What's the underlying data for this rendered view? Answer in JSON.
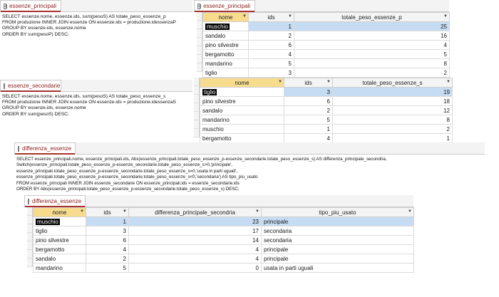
{
  "panels": {
    "sql1": {
      "tab": "essenze_principali",
      "sql": "SELECT essenze.nome, essenze.ids, sum(pesoS) AS totale_peso_essenze_p\nFROM produzione INNER JOIN essenze ON essenze.ids = produzione.idessenzaP\nGROUP BY essenze.ids, essenze.nome\nORDER BY sum(pesoP) DESC;"
    },
    "grid1": {
      "tab": "essenze_principali",
      "columns": [
        "nome",
        "ids",
        "totale_peso_essenze_p"
      ],
      "rows": [
        [
          "muschio",
          "1",
          "25"
        ],
        [
          "sandalo",
          "2",
          "16"
        ],
        [
          "pino silvestre",
          "6",
          "4"
        ],
        [
          "bergamotto",
          "4",
          "5"
        ],
        [
          "mandarino",
          "5",
          "8"
        ],
        [
          "tiglio",
          "3",
          "2"
        ]
      ]
    },
    "sql2": {
      "tab": "essenze_secondarie",
      "sql": "SELECT essenze.nome, essenze.ids, sum(pesoS) AS totale_peso_essenze_s\nFROM produzione INNER JOIN essenze ON essenze.ids = produzione.idessenzaS\nGROUP BY essenze.ids, essenze.nome\nORDER BY sum(pesoS) DESC;"
    },
    "grid2": {
      "columns": [
        "nome",
        "ids",
        "totale_peso_essenze_s"
      ],
      "rows": [
        [
          "tiglio",
          "3",
          "19"
        ],
        [
          "pino silvestre",
          "6",
          "18"
        ],
        [
          "sandalo",
          "2",
          "12"
        ],
        [
          "mandarino",
          "5",
          "8"
        ],
        [
          "muschio",
          "1",
          "2"
        ],
        [
          "bergamotto",
          "4",
          "1"
        ]
      ]
    },
    "sql3": {
      "tab": "differenza_essenze",
      "sql": "SELECT essenze_principali.nome, essenze_principali.ids, Abs(essenze_principali.totale_peso_essenze_p-essenze_secondarie.totale_peso_essenze_s) AS differenza_principale_secondria,\nSwitch(essenze_principali.totale_peso_essenze_p-essenze_secondarie.totale_peso_essenze_s>0,'principale',\nessenze_principali.totale_peso_essenze_p-essenze_secondarie.totale_peso_essenze_s=0,'usata in parti uguali',\nessenze_principali.totale_peso_essenze_p-essenze_secondarie.totale_peso_essenze_s<0,'secondaria') AS tipo_piu_usato\nFROM essenze_principali INNER JOIN essenze_secondarie ON essenze_principali.ids = essenze_secondarie.ids\nORDER BY Abs(essenze_principali.totale_peso_essenze_p-essenze_secondarie.totale_peso_essenze_s) DESC;"
    },
    "grid3": {
      "tab": "differenza_essenze",
      "columns": [
        "nome",
        "ids",
        "differenza_principale_secondria",
        "tipo_piu_usato"
      ],
      "rows": [
        [
          "muschio",
          "1",
          "23",
          "principale"
        ],
        [
          "tiglio",
          "3",
          "17",
          "secondaria"
        ],
        [
          "pino silvestre",
          "6",
          "14",
          "secondaria"
        ],
        [
          "bergamotto",
          "4",
          "4",
          "principale"
        ],
        [
          "sandalo",
          "2",
          "4",
          "principale"
        ],
        [
          "mandarino",
          "5",
          "0",
          "usata in parti uguali"
        ]
      ]
    }
  }
}
